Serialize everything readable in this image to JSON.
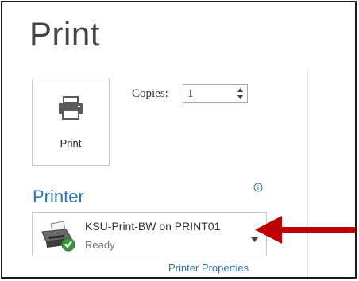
{
  "backstage": {
    "title": "Print",
    "print_button": {
      "label": "Print",
      "icon": "printer-icon"
    },
    "copies": {
      "label": "Copies:",
      "value": "1"
    },
    "printer_section": {
      "title": "Printer",
      "info_icon": "info-icon",
      "selected_printer": {
        "name": "KSU-Print-BW on PRINT01",
        "status": "Ready",
        "icon": "network-printer-ready-icon"
      },
      "properties_link": "Printer Properties"
    },
    "annotation": {
      "icon": "red-arrow-icon",
      "color": "#c00000"
    }
  },
  "colors": {
    "accent_blue": "#2e74b5",
    "text_gray": "#444444",
    "status_green": "#3a9a3a"
  }
}
